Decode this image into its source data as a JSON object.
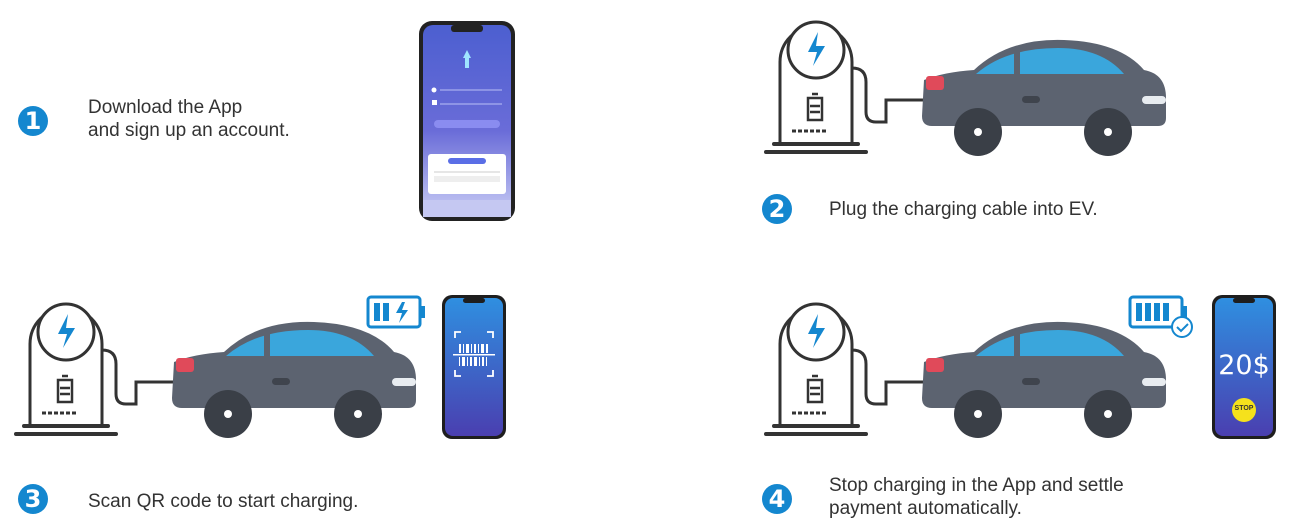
{
  "steps": [
    {
      "number": "1",
      "line1": "Download the App",
      "line2": "and sign up an account."
    },
    {
      "number": "2",
      "line1": "Plug the charging cable into EV."
    },
    {
      "number": "3",
      "line1": "Scan QR code to start charging."
    },
    {
      "number": "4",
      "line1": "Stop charging in the App and settle",
      "line2": "payment automatically."
    }
  ],
  "phone_payment": {
    "amount": "20$",
    "stop_label": "STOP"
  },
  "colors": {
    "accent": "#1487cf",
    "car_body": "#5c6370",
    "car_glass": "#3aa6dc",
    "tail_light": "#e04a5a",
    "phone_gradient_top": "#2f8fe0",
    "phone_gradient_bottom": "#4a3fb0"
  },
  "icons": [
    "lightning-icon",
    "battery-icon",
    "qr-scan-icon",
    "battery-charging-icon",
    "battery-full-check-icon"
  ]
}
